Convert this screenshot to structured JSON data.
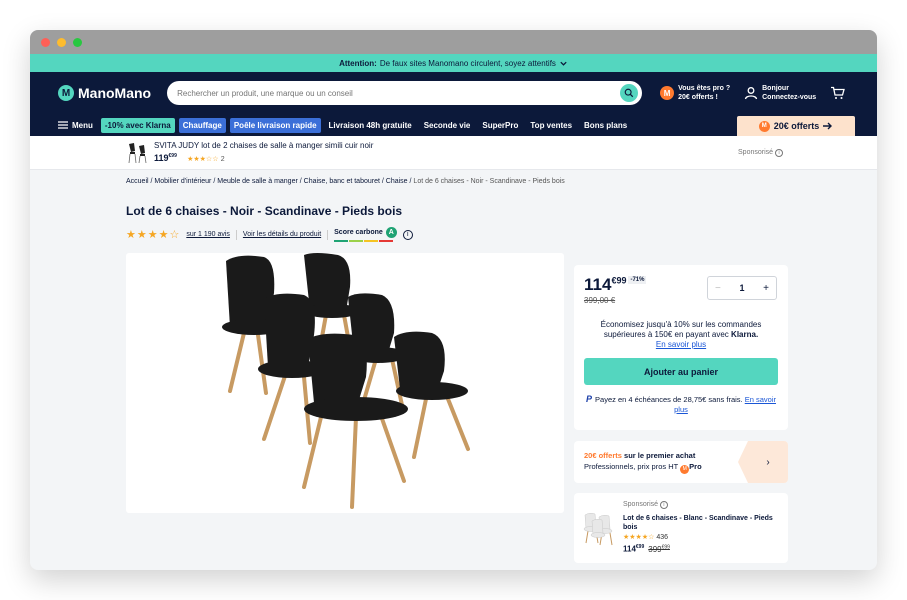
{
  "colors": {
    "brand_navy": "#0c193a",
    "brand_teal": "#54d6bf",
    "accent_orange": "#ff7a2f",
    "link_blue": "#1a56d6"
  },
  "alert": {
    "label": "Attention:",
    "text": "De faux sites Manomano circulent, soyez attentifs",
    "icon": "chevron-down-icon"
  },
  "header": {
    "logo": "ManoMano",
    "search_placeholder": "Rechercher un produit, une marque ou un conseil",
    "pro_line1": "Vous êtes pro ?",
    "pro_line2": "20€ offerts !",
    "account_line1": "Bonjour",
    "account_line2": "Connectez-vous"
  },
  "nav": {
    "menu": "Menu",
    "items": [
      "-10% avec Klarna",
      "Chauffage",
      "Poêle livraison rapide",
      "Livraison 48h gratuite",
      "Seconde vie",
      "SuperPro",
      "Top ventes",
      "Bons plans"
    ],
    "offer": "20€ offerts"
  },
  "sponsored_bar": {
    "title": "SVITA JUDY lot de 2 chaises de salle à manger simili cuir noir",
    "price_main": "119",
    "price_cents": "€99",
    "rating_count": "2",
    "sponsored_label": "Sponsorisé"
  },
  "breadcrumb": {
    "items": [
      "Accueil",
      "Mobilier d'intérieur",
      "Meuble de salle à manger",
      "Chaise, banc et tabouret",
      "Chaise"
    ],
    "current": "Lot de 6 chaises - Noir - Scandinave - Pieds bois"
  },
  "product": {
    "title": "Lot de 6 chaises - Noir - Scandinave - Pieds bois",
    "rating": 4,
    "reviews": "sur 1 190 avis",
    "details_link": "Voir les détails du produit",
    "carbon_label": "Score carbone",
    "carbon_grade": "A"
  },
  "buy_box": {
    "price_main": "114",
    "price_cents": "€99",
    "discount": "-71%",
    "old_price": "399,00 €",
    "quantity": "1",
    "klarna_text": "Économisez jusqu'à 10% sur les commandes supérieures à 150€ en payant avec",
    "klarna_brand": "Klarna.",
    "learn_more": "En savoir plus",
    "add_to_cart": "Ajouter au panier",
    "paypal_text": "Payez en 4 échéances de 28,75€ sans frais.",
    "paypal_link": "En savoir plus"
  },
  "pro_offer": {
    "highlight": "20€ offerts",
    "text": "sur le premier achat",
    "line2": "Professionnels, prix pros HT",
    "pro_brand": "Pro"
  },
  "sponsored_card": {
    "label": "Sponsorisé",
    "title": "Lot de 6 chaises - Blanc - Scandinave - Pieds bois",
    "rating_count": "436",
    "price_main": "114",
    "price_cents": "€99",
    "old_main": "399",
    "old_cents": "€99"
  }
}
